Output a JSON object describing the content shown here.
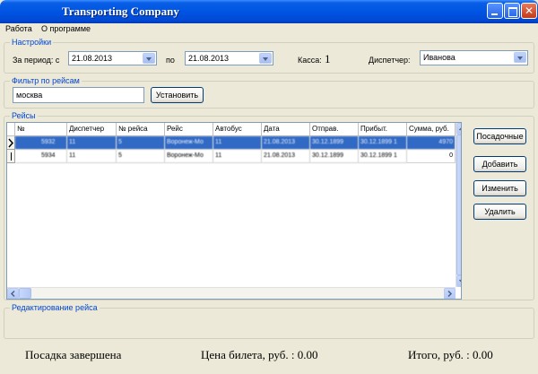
{
  "window": {
    "title": "Transporting Company"
  },
  "menu": [
    {
      "label": "Работа"
    },
    {
      "label": "О программе"
    }
  ],
  "settings": {
    "group_label": "Настройки",
    "period_label": "За период: с",
    "date_from": "21.08.2013",
    "to_label": "по",
    "date_to": "21.08.2013",
    "kassa_label": "Касса:",
    "kassa_value": "1",
    "dispatcher_label": "Диспетчер:",
    "dispatcher_value": "Иванова"
  },
  "filter": {
    "group_label": "Фильтр по рейсам",
    "value": "москва",
    "apply_label": "Установить"
  },
  "flights": {
    "group_label": "Рейсы",
    "columns": [
      "№",
      "Диспетчер",
      "№ рейса",
      "Рейс",
      "Автобус",
      "Дата",
      "Отправ.",
      "Прибыт.",
      "Сумма, руб."
    ],
    "rows": [
      [
        "5932",
        "11",
        "5",
        "Воронеж-Мо",
        "11",
        "21.08.2013",
        "30.12.1899",
        "30.12.1899 1",
        "4970"
      ],
      [
        "5934",
        "11",
        "5",
        "Воронеж-Мо",
        "11",
        "21.08.2013",
        "30.12.1899",
        "30.12.1899 1",
        "0"
      ]
    ],
    "actions": {
      "boarding": "Посадочные",
      "add": "Добавить",
      "edit": "Изменить",
      "delete": "Удалить"
    }
  },
  "edit_group": {
    "label": "Редактирование рейса"
  },
  "status": {
    "boarding_done": "Посадка завершена",
    "ticket_price": "Цена билета, руб. : 0.00",
    "total": "Итого, руб. : 0.00"
  }
}
